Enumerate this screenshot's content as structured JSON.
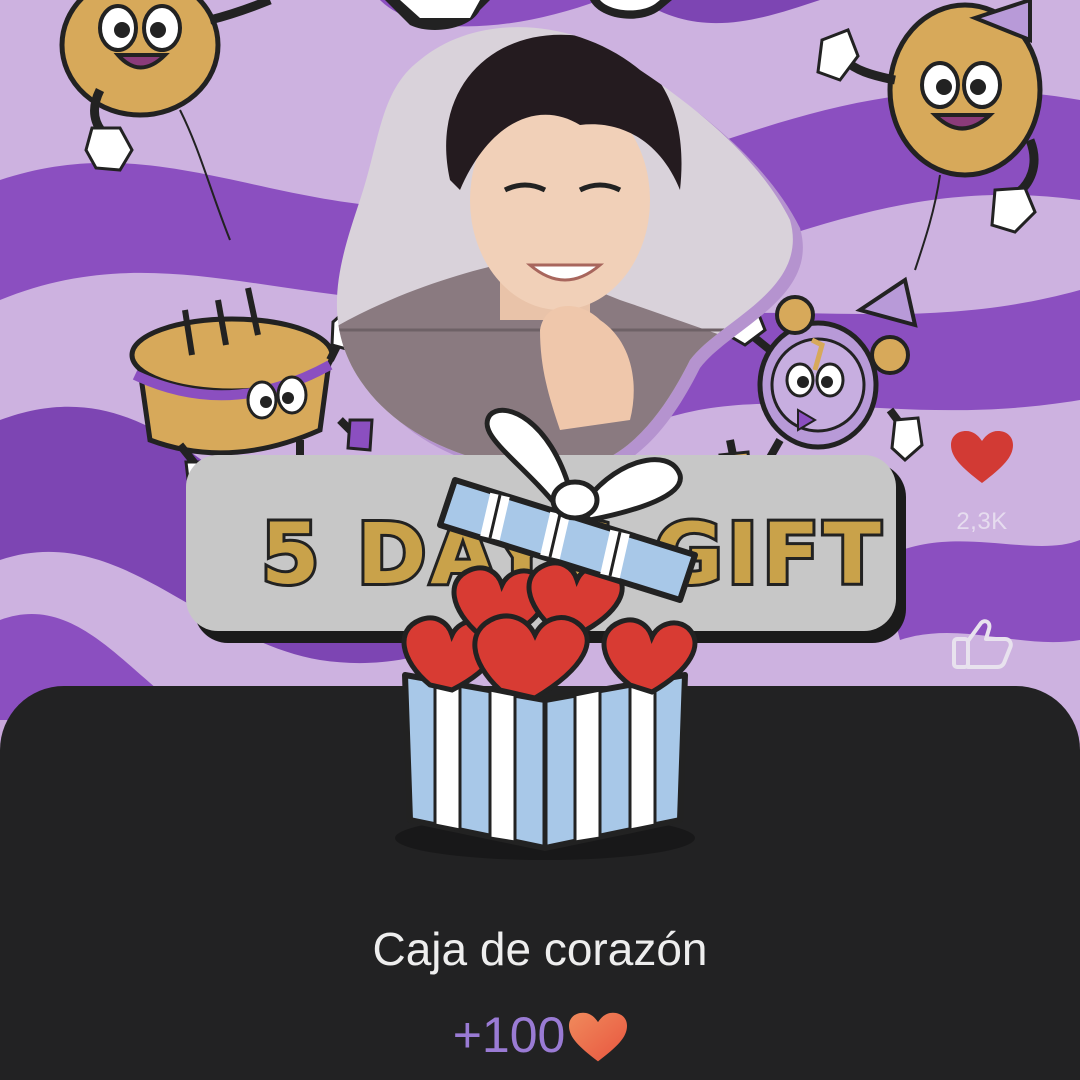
{
  "banner": {
    "text": "5 DAYS GIFT"
  },
  "side_actions": {
    "heart_count": "2,3K",
    "heart_icon": "heart-icon",
    "like_icon": "thumbs-up-icon"
  },
  "gift": {
    "name": "Caja de corazón",
    "reward": "+100",
    "reward_icon": "heart-icon"
  },
  "colors": {
    "purple_swirl": "#8b4fc0",
    "lavender": "#c9a8db",
    "sheet": "#222223",
    "heart_red": "#dd3b35",
    "reward_text": "#9a7bd4",
    "banner_text": "#c9a24a"
  }
}
